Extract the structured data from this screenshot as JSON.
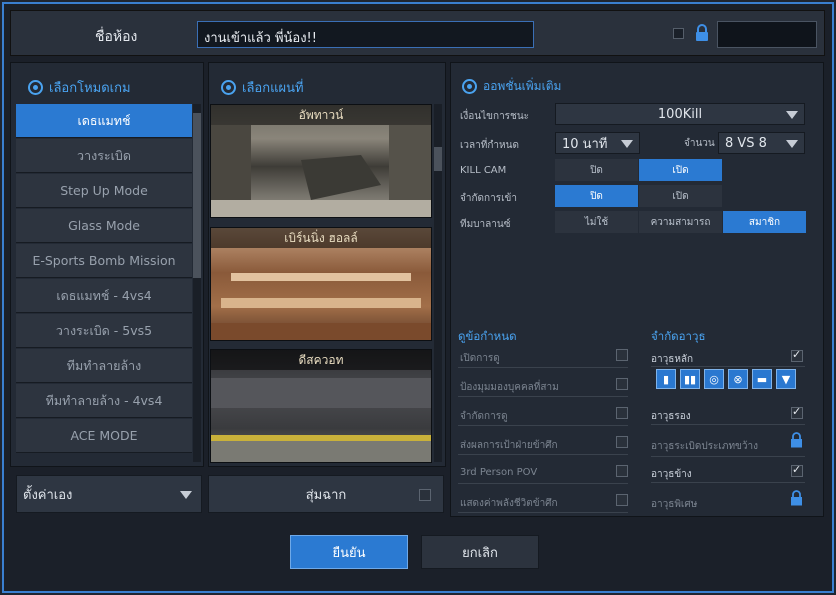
{
  "header": {
    "room_label": "ชื่อห้อง",
    "room_name": "งานเข้าแล้ว พี่น้อง!!"
  },
  "modes": {
    "title": "เลือกโหมดเกม",
    "items": [
      "เดธแมทช์",
      "วางระเบิด",
      "Step Up Mode",
      "Glass Mode",
      "E-Sports Bomb Mission",
      "เดธแมทช์ - 4vs4",
      "วางระเบิด - 5vs5",
      "ทีมทำลายล้าง",
      "ทีมทำลายล้าง - 4vs4",
      "ACE MODE"
    ],
    "selected_index": 0,
    "custom_label": "ตั้งค่าเอง"
  },
  "maps": {
    "title": "เลือกแผนที่",
    "items": [
      "อัพทาวน์",
      "เบิร์นนิ่ง ฮอลล์",
      "ดีสควอท"
    ],
    "random_label": "สุ่มฉาก"
  },
  "options": {
    "title": "ออพชั่นเพิ่มเติม",
    "win_label": "เงื่อนไขการชนะ",
    "win_value": "100Kill",
    "time_label": "เวลาที่กำหนด",
    "time_value": "10 นาที",
    "count_label": "จำนวน",
    "count_value": "8 VS 8",
    "killcam_label": "KILL CAM",
    "killcam_off": "ปิด",
    "killcam_on": "เปิด",
    "entry_label": "จำกัดการเข้า",
    "entry_on": "ปิด",
    "entry_off": "เปิด",
    "balance_label": "ทีมบาลานซ์",
    "balance_opts": [
      "ไม่ใช้",
      "ความสามารถ",
      "สมาชิก"
    ],
    "balance_selected": 2
  },
  "rules": {
    "title": "ดูข้อกำหนด",
    "items": [
      "เปิดการดู",
      "ป้องมุมมองบุคคลที่สาม",
      "จำกัดการดู",
      "ส่งผลการเป้าฝ่ายข้าศึก",
      "3rd Person POV",
      "แสดงค่าพลังชีวิตข้าศึก"
    ]
  },
  "weapons": {
    "title": "จำกัดอาวุธ",
    "primary": "อาวุธหลัก",
    "secondary": "อาวุธรอง",
    "grenade": "อาวุธระเบิดประเภทขว้าง",
    "melee": "อาวุธข้าง",
    "special": "อาวุธพิเศษ",
    "primary_icons": [
      "sniper-icon",
      "ammo-icon",
      "target-icon",
      "crosshair-icon",
      "shotgun-icon",
      "shield-icon"
    ]
  },
  "footer": {
    "confirm": "ยืนยัน",
    "cancel": "ยกเลิก"
  },
  "colors": {
    "accent": "#2b7ad2",
    "highlight": "#4aa3f0",
    "frame": "#3a7fd0"
  }
}
